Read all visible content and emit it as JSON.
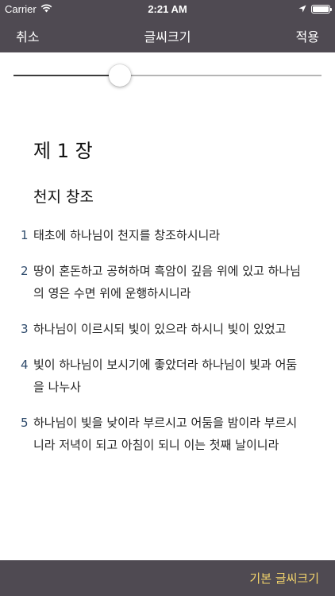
{
  "status_bar": {
    "carrier": "Carrier",
    "time": "2:21 AM",
    "icons": [
      "wifi-icon",
      "location-arrow-icon",
      "battery-icon"
    ]
  },
  "nav": {
    "cancel_label": "취소",
    "title": "글씨크기",
    "apply_label": "적용"
  },
  "font_size_slider": {
    "value_fraction": 0.345
  },
  "content": {
    "chapter_title": "제 1 장",
    "section_title": "천지 창조",
    "verses": [
      {
        "num": "1",
        "text": "태초에 하나님이 천지를 창조하시니라"
      },
      {
        "num": "2",
        "text": "땅이 혼돈하고 공허하며 흑암이 깊음 위에 있고 하나님의 영은 수면 위에 운행하시니라"
      },
      {
        "num": "3",
        "text": "하나님이 이르시되 빛이 있으라 하시니 빛이 있었고"
      },
      {
        "num": "4",
        "text": "빛이 하나님이 보시기에 좋았더라 하나님이 빛과 어둠을 나누사"
      },
      {
        "num": "5",
        "text": "하나님이 빛을 낮이라 부르시고 어둠을 밤이라 부르시니라 저녁이 되고 아침이 되니 이는 첫째 날이니라"
      }
    ]
  },
  "bottom_bar": {
    "default_size_label": "기본 글씨크기"
  },
  "colors": {
    "bar_background": "#4f4a52",
    "accent_yellow": "#f2d36b",
    "verse_number": "#2e4a6b"
  }
}
